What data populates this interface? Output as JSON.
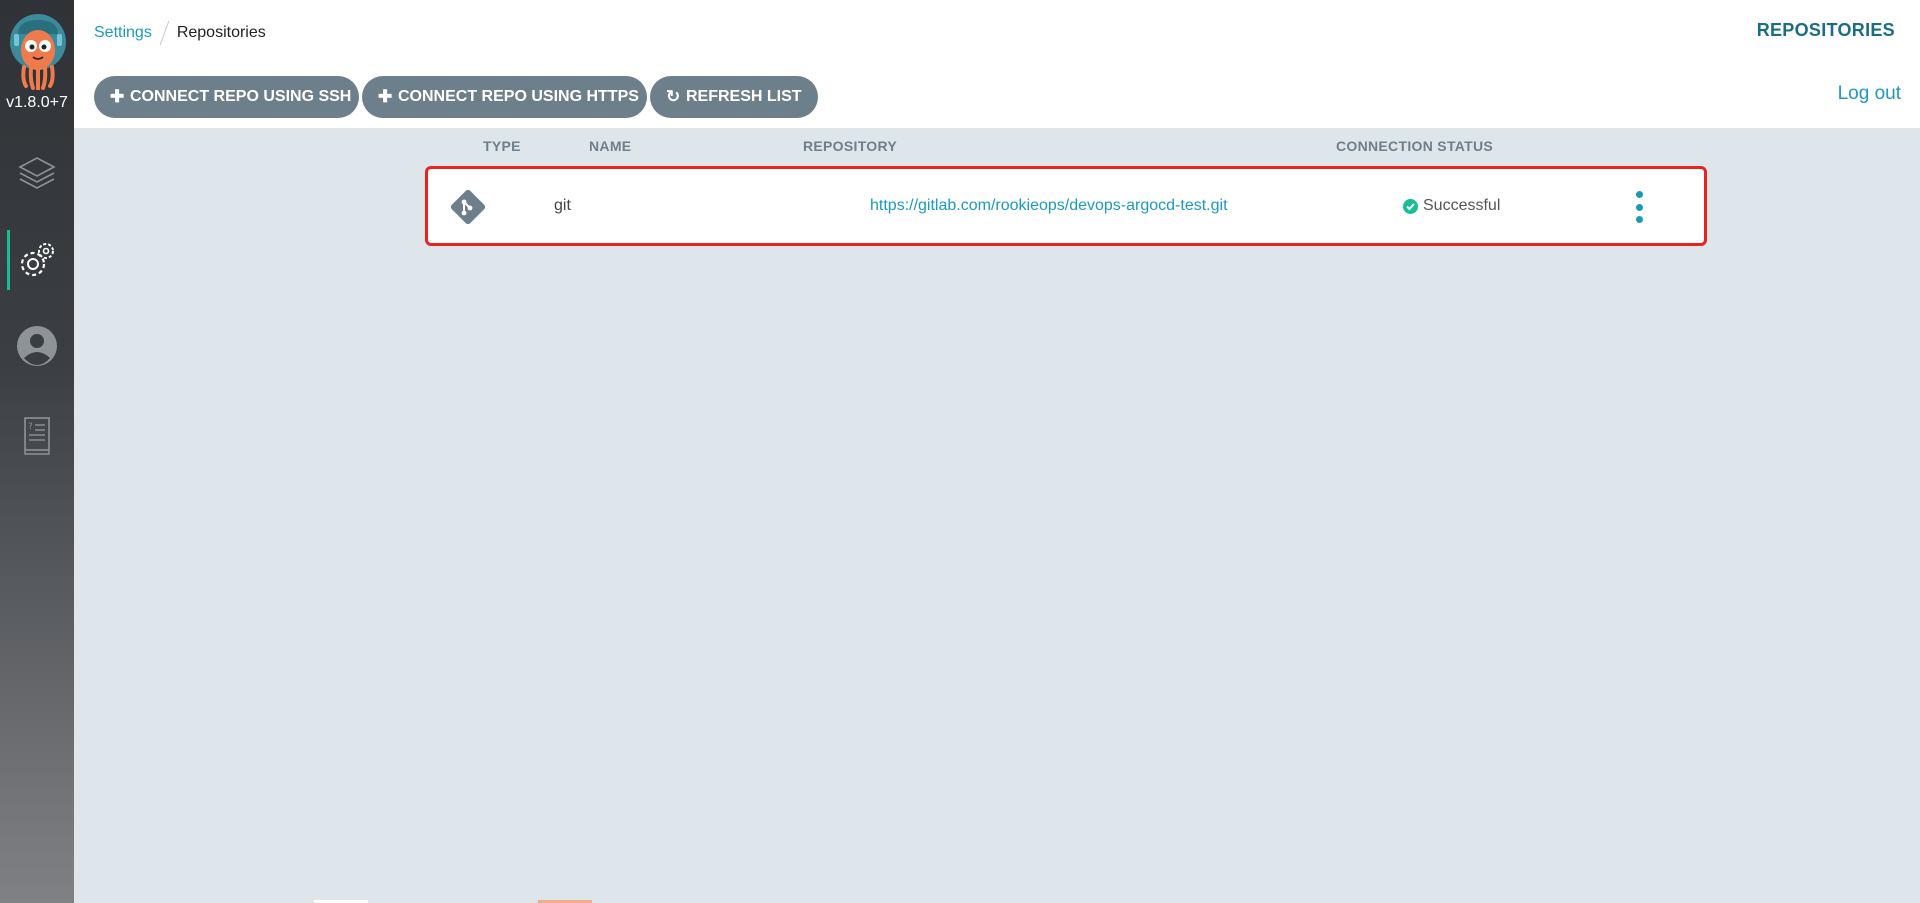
{
  "app": {
    "version": "v1.8.0+7"
  },
  "breadcrumb": {
    "parent": "Settings",
    "current": "Repositories"
  },
  "header": {
    "title": "REPOSITORIES"
  },
  "toolbar": {
    "connect_ssh": "CONNECT REPO USING SSH",
    "connect_https": "CONNECT REPO USING HTTPS",
    "refresh": "REFRESH LIST",
    "logout": "Log out"
  },
  "table": {
    "columns": [
      "TYPE",
      "NAME",
      "REPOSITORY",
      "CONNECTION STATUS"
    ],
    "rows": [
      {
        "icon": "git-icon",
        "type": "git",
        "name": "",
        "repository": "https://gitlab.com/rookieops/devops-argocd-test.git",
        "status": "Successful"
      }
    ]
  },
  "colors": {
    "accent": "#1c9bba",
    "success": "#18be94",
    "button": "#6d7f8b",
    "highlight": "#e9241e"
  }
}
